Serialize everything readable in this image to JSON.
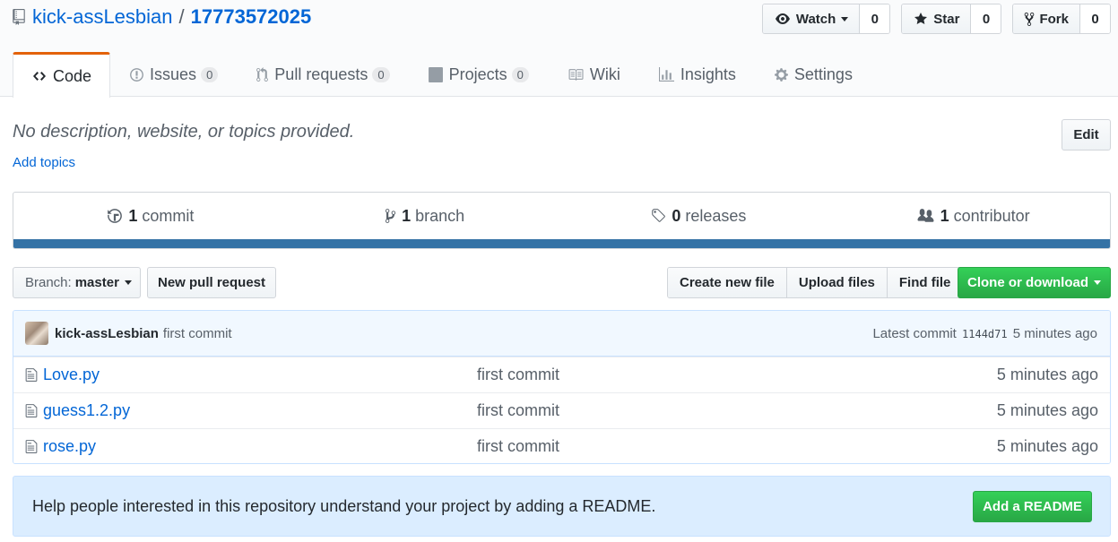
{
  "repo": {
    "owner": "kick-assLesbian",
    "separator": "/",
    "name": "17773572025"
  },
  "actions": {
    "watch": {
      "label": "Watch",
      "count": "0"
    },
    "star": {
      "label": "Star",
      "count": "0"
    },
    "fork": {
      "label": "Fork",
      "count": "0"
    }
  },
  "tabs": [
    {
      "label": "Code",
      "icon": "code-icon",
      "selected": true
    },
    {
      "label": "Issues",
      "counter": "0",
      "icon": "issue-icon"
    },
    {
      "label": "Pull requests",
      "counter": "0",
      "icon": "pull-request-icon"
    },
    {
      "label": "Projects",
      "counter": "0",
      "icon": "project-icon"
    },
    {
      "label": "Wiki",
      "icon": "book-icon"
    },
    {
      "label": "Insights",
      "icon": "graph-icon"
    },
    {
      "label": "Settings",
      "icon": "gear-icon"
    }
  ],
  "description": {
    "text": "No description, website, or topics provided.",
    "add_topics": "Add topics",
    "edit": "Edit"
  },
  "summary": {
    "commits": {
      "num": "1",
      "label": "commit"
    },
    "branches": {
      "num": "1",
      "label": "branch"
    },
    "releases": {
      "num": "0",
      "label": "releases"
    },
    "contributors": {
      "num": "1",
      "label": "contributor"
    },
    "language_color": "#3572a5"
  },
  "file_nav": {
    "branch_label": "Branch:",
    "branch_name": "master",
    "new_pr": "New pull request",
    "create_file": "Create new file",
    "upload_files": "Upload files",
    "find_file": "Find file",
    "clone": "Clone or download"
  },
  "latest_commit": {
    "author": "kick-assLesbian",
    "message": "first commit",
    "prefix": "Latest commit",
    "sha": "1144d71",
    "age": "5 minutes ago"
  },
  "files": [
    {
      "name": "Love.py",
      "message": "first commit",
      "age": "5 minutes ago"
    },
    {
      "name": "guess1.2.py",
      "message": "first commit",
      "age": "5 minutes ago"
    },
    {
      "name": "rose.py",
      "message": "first commit",
      "age": "5 minutes ago"
    }
  ],
  "readme_prompt": {
    "text": "Help people interested in this repository understand your project by adding a README.",
    "button": "Add a README"
  },
  "colors": {
    "link": "#0366d6",
    "accent_tab": "#e36209",
    "primary_button": "#28a745"
  }
}
